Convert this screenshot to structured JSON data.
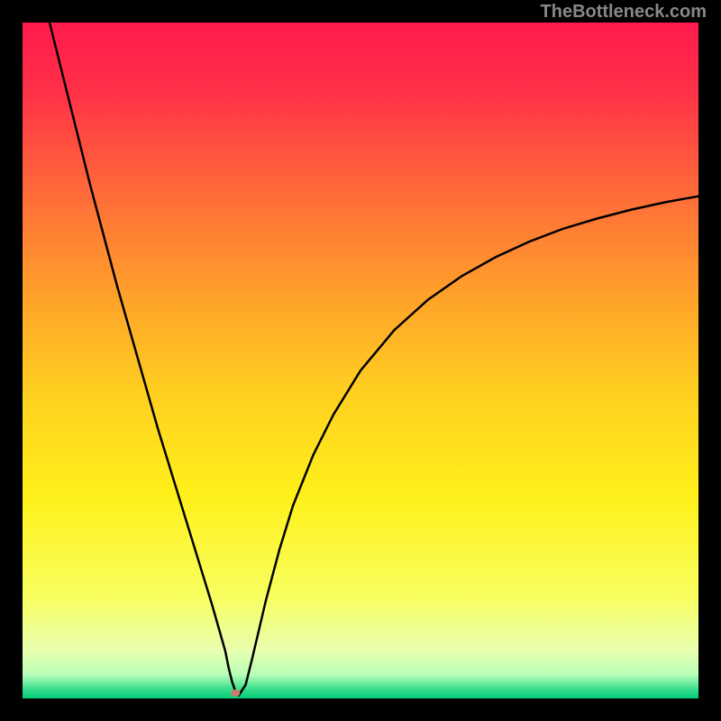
{
  "watermark": "TheBottleneck.com",
  "chart_data": {
    "type": "line",
    "title": "",
    "xlabel": "",
    "ylabel": "",
    "xlim": [
      0,
      100
    ],
    "ylim": [
      0,
      100
    ],
    "background_gradient": {
      "stops": [
        {
          "pos": 0.0,
          "color": "#ff1a4d"
        },
        {
          "pos": 0.1,
          "color": "#ff3047"
        },
        {
          "pos": 0.25,
          "color": "#ff6a3a"
        },
        {
          "pos": 0.4,
          "color": "#ffa02a"
        },
        {
          "pos": 0.55,
          "color": "#ffd020"
        },
        {
          "pos": 0.7,
          "color": "#fff01a"
        },
        {
          "pos": 0.85,
          "color": "#f8ff60"
        },
        {
          "pos": 0.93,
          "color": "#e8ffb0"
        },
        {
          "pos": 0.965,
          "color": "#b8ffb8"
        },
        {
          "pos": 0.985,
          "color": "#40e090"
        },
        {
          "pos": 1.0,
          "color": "#00cc77"
        }
      ]
    },
    "series": [
      {
        "name": "bottleneck-curve",
        "color": "#000000",
        "stroke_width": 2.5,
        "x": [
          4,
          6,
          8,
          10,
          12,
          14,
          16,
          18,
          20,
          22,
          24,
          26,
          28,
          29,
          30,
          30.5,
          31,
          31.5,
          32,
          33,
          34,
          36,
          38,
          40,
          43,
          46,
          50,
          55,
          60,
          65,
          70,
          75,
          80,
          85,
          90,
          95,
          100
        ],
        "y": [
          100,
          92,
          84,
          76,
          68.5,
          61,
          54,
          47,
          40,
          33.5,
          27,
          20.5,
          14,
          10.5,
          7,
          4.5,
          2.5,
          1,
          0.5,
          2,
          6,
          14.5,
          22,
          28.5,
          36,
          42,
          48.5,
          54.5,
          59,
          62.5,
          65.3,
          67.6,
          69.5,
          71,
          72.3,
          73.4,
          74.3
        ]
      }
    ],
    "marker": {
      "x": 31.5,
      "y": 0.8,
      "color": "#c97c6e",
      "rx": 5,
      "ry": 4
    }
  }
}
